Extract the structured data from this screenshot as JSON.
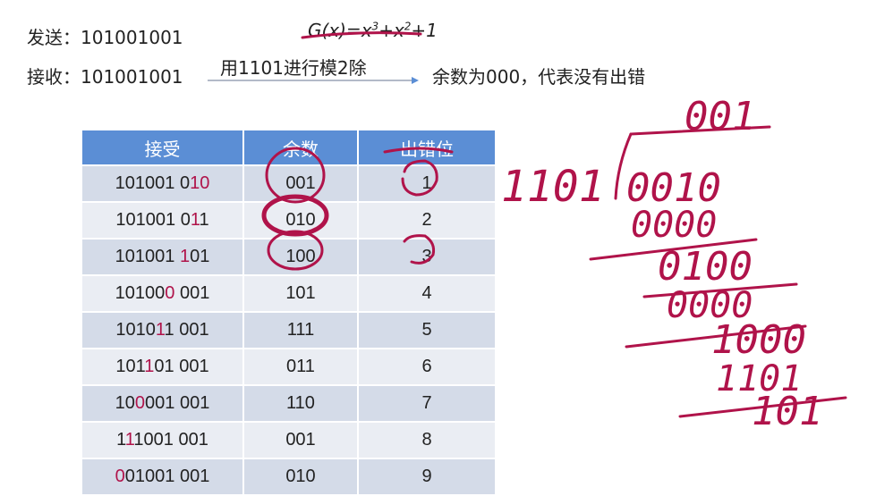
{
  "send": {
    "label": "发送：",
    "value": "101001001"
  },
  "receive": {
    "label": "接收：",
    "value": "101001001"
  },
  "generator": {
    "prefix": "G(x)=x",
    "exp1": "3",
    "mid": "+x",
    "exp2": "2",
    "suffix": "+1"
  },
  "method": "用1101进行模2除",
  "result": "余数为000，代表没有出错",
  "table": {
    "headers": [
      "接受",
      "余数",
      "出错位"
    ],
    "rows": [
      {
        "recv": "101001 010",
        "rem": "001",
        "pos": "1"
      },
      {
        "recv": "101001 011",
        "rem": "010",
        "pos": "2"
      },
      {
        "recv": "101001 101",
        "rem": "100",
        "pos": "3"
      },
      {
        "recv": "101000 001",
        "rem": "101",
        "pos": "4"
      },
      {
        "recv": "101011 001",
        "rem": "111",
        "pos": "5"
      },
      {
        "recv": "101101 001",
        "rem": "011",
        "pos": "6"
      },
      {
        "recv": "100001 001",
        "rem": "110",
        "pos": "7"
      },
      {
        "recv": "111001 001",
        "rem": "001",
        "pos": "8"
      },
      {
        "recv": "001001 001",
        "rem": "010",
        "pos": "9"
      }
    ]
  },
  "handwriting": {
    "quotient": "001",
    "divisor": "1101",
    "dividend": "0010",
    "steps": [
      "0000",
      "0100",
      "0000",
      "1000",
      "1101",
      "101"
    ]
  },
  "colors": {
    "header": "#5b8ed5",
    "row_odd": "#d4dbe8",
    "row_even": "#eaedf3",
    "ink": "#b0134a"
  }
}
